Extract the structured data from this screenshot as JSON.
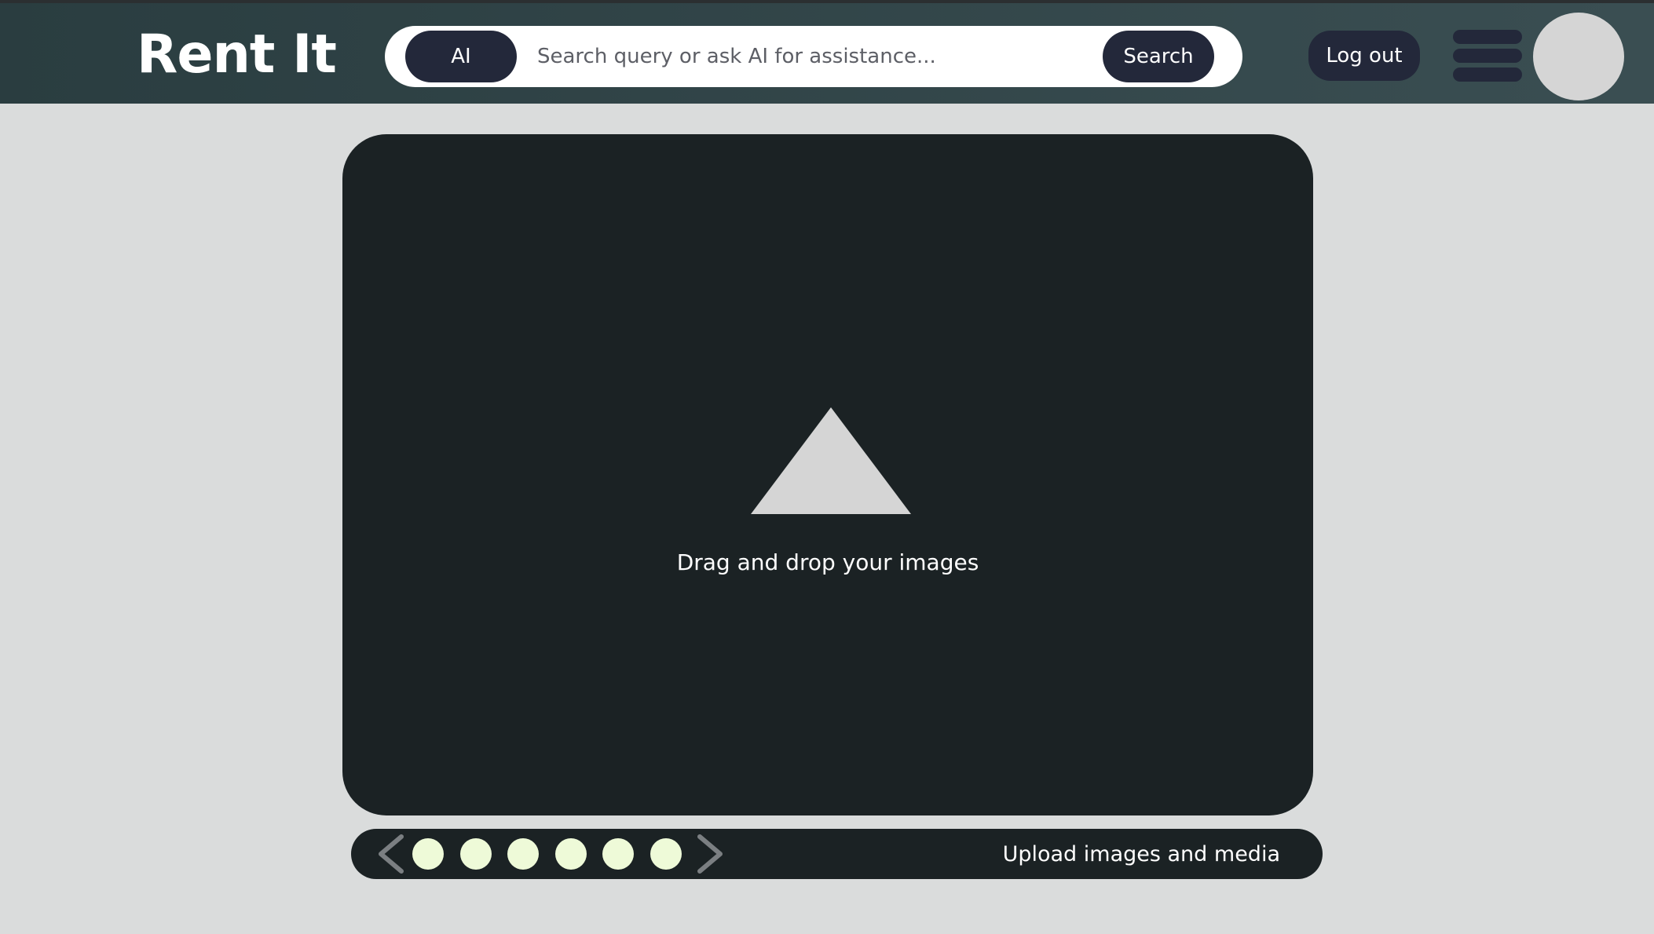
{
  "header": {
    "logo": "Rent It",
    "ai_label": "AI",
    "search_placeholder": "Search query or ask AI for assistance...",
    "search_label": "Search",
    "logout_label": "Log out"
  },
  "dropzone": {
    "label": "Drag and drop your images",
    "icon": "upload-triangle-icon"
  },
  "carousel": {
    "dot_count": 6,
    "upload_label": "Upload images and media",
    "prev_icon": "chevron-left-icon",
    "next_icon": "chevron-right-icon"
  },
  "colors": {
    "header_bg": "#33464a",
    "panel_bg": "#1b2224",
    "button_bg": "#23283a",
    "dot": "#eefad8",
    "page_bg": "#dadcdc"
  }
}
